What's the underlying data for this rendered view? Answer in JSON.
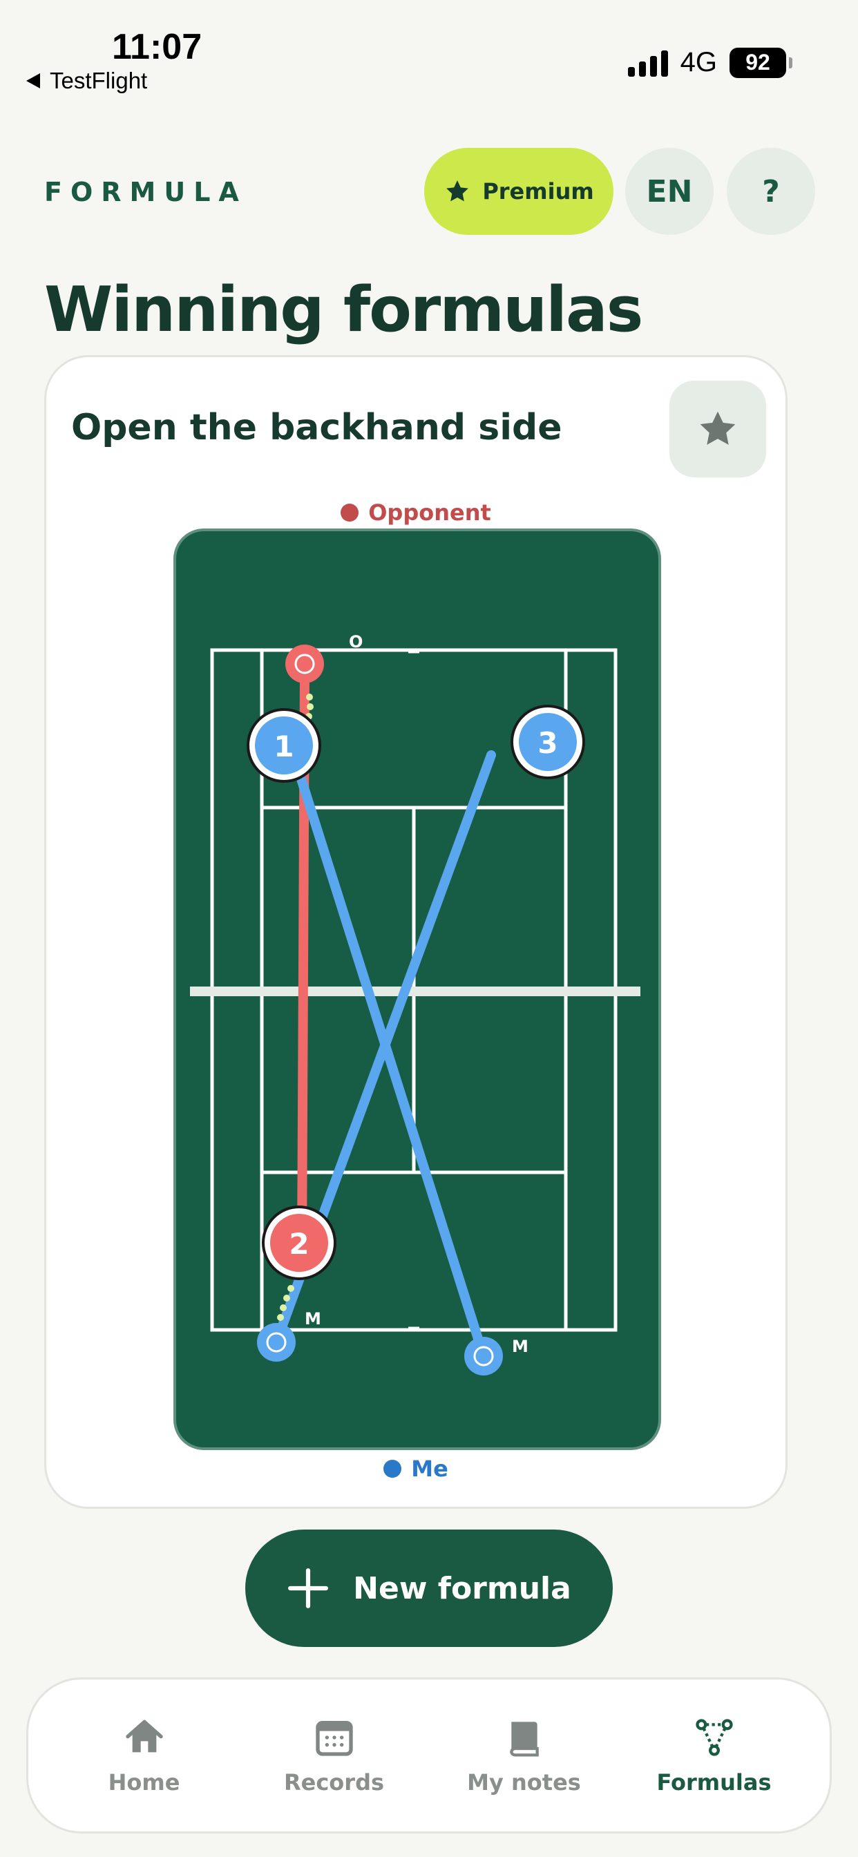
{
  "status_bar": {
    "time": "11:07",
    "back_label": "TestFlight",
    "network": "4G",
    "battery": "92"
  },
  "header": {
    "brand": "FORMULA",
    "premium_label": "Premium",
    "language": "EN",
    "help": "?"
  },
  "page_title": "Winning formulas",
  "card": {
    "title": "Open the backhand side",
    "legend_opponent": "Opponent",
    "legend_me": "Me",
    "court": {
      "shots": [
        {
          "number": "1",
          "player": "me"
        },
        {
          "number": "2",
          "player": "opponent"
        },
        {
          "number": "3",
          "player": "me"
        }
      ],
      "opponent_start_label": "O",
      "me_start_label": "M",
      "me_end_label": "M"
    }
  },
  "new_formula_label": "New formula",
  "tabs": [
    {
      "label": "Home",
      "icon": "home-icon"
    },
    {
      "label": "Records",
      "icon": "calendar-icon"
    },
    {
      "label": "My notes",
      "icon": "book-icon"
    },
    {
      "label": "Formulas",
      "icon": "formula-graph-icon",
      "active": true
    }
  ],
  "colors": {
    "brand_green": "#1b5a42",
    "court_green": "#175c45",
    "premium_lime": "#cde84a",
    "opponent_red": "#f06a6a",
    "me_blue": "#5aa7f0"
  }
}
